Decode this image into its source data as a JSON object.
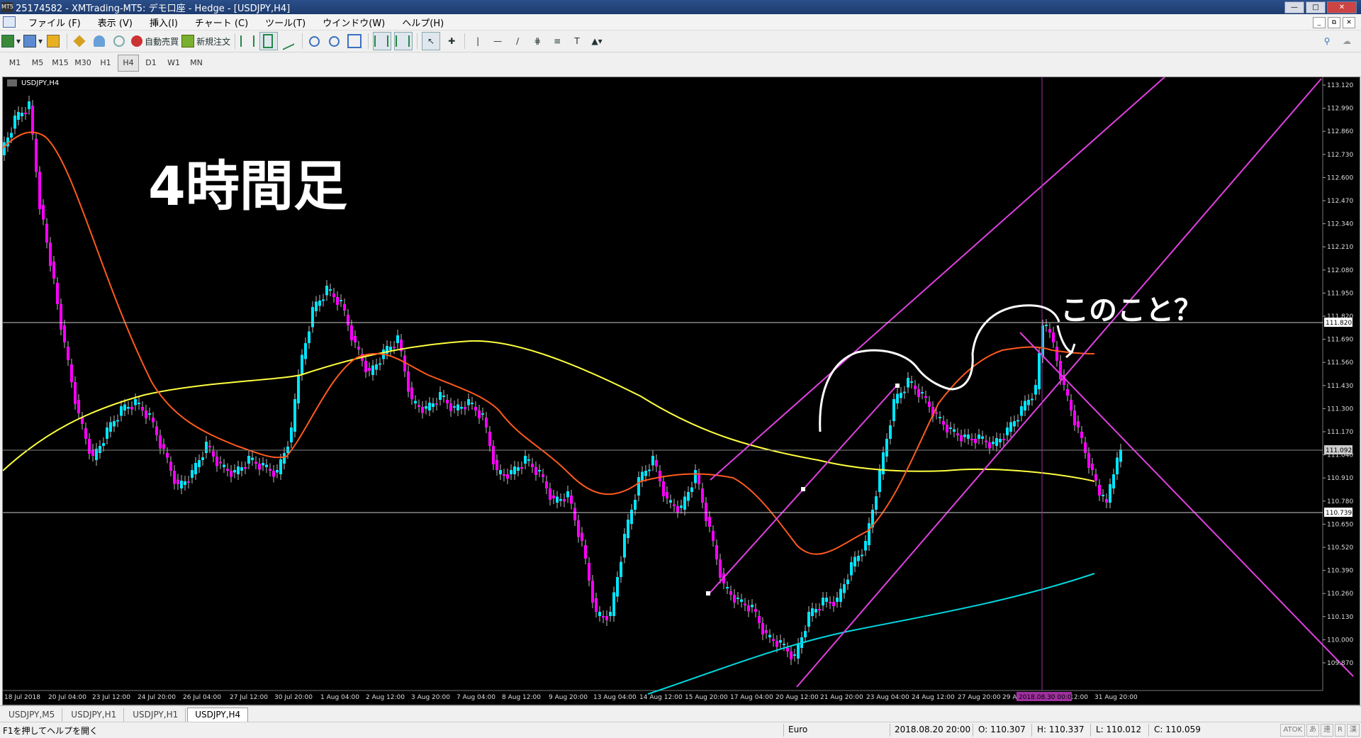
{
  "titlebar": {
    "title": "25174582 - XMTrading-MT5: デモ口座 - Hedge - [USDJPY,H4]",
    "app_icon": "MT5"
  },
  "menu": [
    "ファイル (F)",
    "表示 (V)",
    "挿入(I)",
    "チャート (C)",
    "ツール(T)",
    "ウインドウ(W)",
    "ヘルプ(H)"
  ],
  "toolbar": {
    "auto_trade": "自動売買",
    "new_order": "新規注文"
  },
  "timeframes": [
    "M1",
    "M5",
    "M15",
    "M30",
    "H1",
    "H4",
    "D1",
    "W1",
    "MN"
  ],
  "active_timeframe": "H4",
  "chart": {
    "symbol_label": "USDJPY,H4",
    "overlay_text": "4時間足",
    "annotation_text": "このこと？",
    "price_labels": [
      "113.120",
      "112.990",
      "112.860",
      "112.730",
      "112.600",
      "112.470",
      "112.340",
      "112.210",
      "112.080",
      "111.950",
      "111.820",
      "111.690",
      "111.560",
      "111.430",
      "111.300",
      "111.170",
      "111.040",
      "110.910",
      "110.780",
      "110.650",
      "110.520",
      "110.390",
      "110.260",
      "110.130",
      "110.000",
      "109.870"
    ],
    "highlight_prices": {
      "line1": "111.820",
      "current": "111.092",
      "line2": "110.739"
    },
    "date_labels": [
      "18 Jul 2018",
      "20 Jul 04:00",
      "23 Jul 12:00",
      "24 Jul 20:00",
      "26 Jul 04:00",
      "27 Jul 12:00",
      "30 Jul 20:00",
      "1 Aug 04:00",
      "2 Aug 12:00",
      "3 Aug 20:00",
      "7 Aug 04:00",
      "8 Aug 12:00",
      "9 Aug 20:00",
      "13 Aug 04:00",
      "14 Aug 12:00",
      "15 Aug 20:00",
      "17 Aug 04:00",
      "20 Aug 12:00",
      "21 Aug 20:00",
      "23 Aug 04:00",
      "24 Aug 12:00",
      "27 Aug 20:00",
      "29 A",
      "12:00",
      "31 Aug 20:00"
    ],
    "crosshair_date": "2018.08.30 00:00",
    "colors": {
      "bull": "#00e5ff",
      "bear": "#ff00ff",
      "ma_fast": "#ff5a1e",
      "ma_slow": "#ffff40",
      "ma_long": "#00d8e0",
      "channel": "#e040e0",
      "bg": "#000000"
    }
  },
  "tabs": [
    "USDJPY,M5",
    "USDJPY,H1",
    "USDJPY,H1",
    "USDJPY,H4"
  ],
  "active_tab": 3,
  "status": {
    "help": "F1を押してヘルプを開く",
    "profile": "Euro",
    "datetime": "2018.08.20 20:00",
    "open": "O: 110.307",
    "high": "H: 110.337",
    "low": "L: 110.012",
    "close": "C: 110.059",
    "ime": [
      "ATOK",
      "あ",
      "連",
      "R",
      "漢"
    ]
  }
}
